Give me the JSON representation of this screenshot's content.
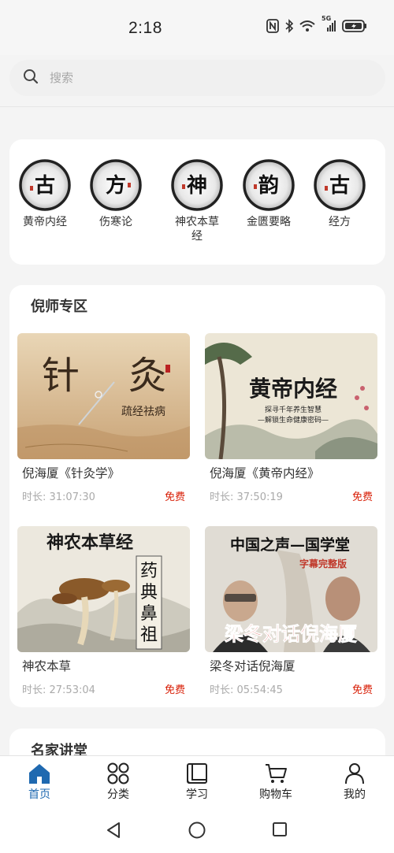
{
  "status": {
    "time": "2:18",
    "network": "5G"
  },
  "search": {
    "placeholder": "搜索"
  },
  "categories": [
    {
      "label": "黄帝内经",
      "glyph": "古"
    },
    {
      "label": "伤寒论",
      "glyph": "方"
    },
    {
      "label": "神农本草经",
      "glyph": "神"
    },
    {
      "label": "金匮要略",
      "glyph": "韵"
    },
    {
      "label": "经方",
      "glyph": "古"
    }
  ],
  "nishi": {
    "title": "倪师专区",
    "videos": [
      {
        "title": "倪海厦《针灸学》",
        "duration": "时长: 31:07:30",
        "price": "免费",
        "thumb": {
          "line1": "针",
          "line2": "灸",
          "sub": "疏经祛病"
        }
      },
      {
        "title": "倪海厦《黄帝内经》",
        "duration": "时长: 37:50:19",
        "price": "免费",
        "thumb": {
          "heading": "黄帝内经",
          "sub1": "探寻千年养生智慧",
          "sub2": "—解锁生命健康密码—"
        }
      },
      {
        "title": "神农本草",
        "duration": "时长: 27:53:04",
        "price": "免费",
        "thumb": {
          "heading": "神农本草经",
          "v1": "药",
          "v2": "典",
          "v3": "鼻",
          "v4": "祖"
        }
      },
      {
        "title": "梁冬对话倪海厦",
        "duration": "时长: 05:54:45",
        "price": "免费",
        "thumb": {
          "heading": "中国之声—国学堂",
          "tag": "字幕完整版",
          "caption": "梁冬对话倪海厦"
        }
      }
    ]
  },
  "mingjia": {
    "title": "名家讲堂"
  },
  "tabs": [
    {
      "label": "首页",
      "icon": "home-icon"
    },
    {
      "label": "分类",
      "icon": "category-icon"
    },
    {
      "label": "学习",
      "icon": "book-icon"
    },
    {
      "label": "购物车",
      "icon": "cart-icon"
    },
    {
      "label": "我的",
      "icon": "user-icon"
    }
  ],
  "colors": {
    "accent": "#1f69b0",
    "free": "#d81e06"
  }
}
